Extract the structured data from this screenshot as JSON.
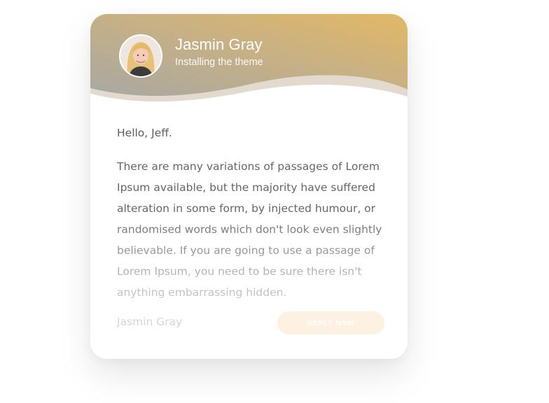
{
  "header": {
    "name": "Jasmin Gray",
    "subtitle": "Installing the theme",
    "avatar_icon": "avatar-photo"
  },
  "message": {
    "greeting": "Hello, Jeff.",
    "body": "There are many variations of passages of Lorem Ipsum available, but the majority have suffered alteration in some form, by injected humour, or randomised words which don't look even slightly believable. If you are going to use a passage of Lorem Ipsum, you need to be sure there isn't anything embarrassing hidden."
  },
  "footer": {
    "signature": "Jasmin Gray",
    "reply_label": "REPLY NOW"
  },
  "colors": {
    "header_gradient_start": "#a9a9a1",
    "header_gradient_end": "#e0b863",
    "reply_button_bg": "#fdf1e2",
    "body_text": "#666666"
  }
}
